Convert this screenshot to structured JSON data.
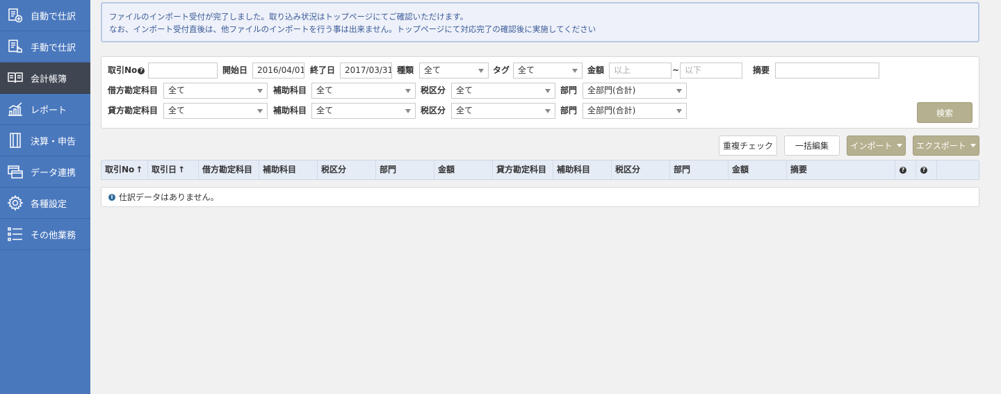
{
  "sidebar": {
    "items": [
      {
        "label": "自動で仕訳",
        "icon": "auto-journal-icon"
      },
      {
        "label": "手動で仕訳",
        "icon": "manual-journal-icon"
      },
      {
        "label": "会計帳簿",
        "icon": "ledger-book-icon",
        "active": true
      },
      {
        "label": "レポート",
        "icon": "report-chart-icon"
      },
      {
        "label": "決算・申告",
        "icon": "settlement-icon"
      },
      {
        "label": "データ連携",
        "icon": "data-link-icon"
      },
      {
        "label": "各種設定",
        "icon": "gear-icon"
      },
      {
        "label": "その他業務",
        "icon": "list-icon"
      }
    ]
  },
  "notice": {
    "line1": "ファイルのインポート受付が完了しました。取り込み状況はトップページにてご確認いただけます。",
    "line2": "なお、インポート受付直後は、他ファイルのインポートを行う事は出来ません。トップページにて対応完了の確認後に実施してください"
  },
  "search": {
    "trade_no_label": "取引No",
    "trade_no_value": "",
    "start_label": "開始日",
    "start_value": "2016/04/01",
    "end_label": "終了日",
    "end_value": "2017/03/31",
    "kind_label": "種類",
    "kind_value": "全て",
    "tag_label": "タグ",
    "tag_value": "全て",
    "amount_label": "金額",
    "amount_min_placeholder": "以上",
    "amount_sep": "~",
    "amount_max_placeholder": "以下",
    "memo_label": "摘要",
    "memo_value": "",
    "debit_label": "借方勘定科目",
    "debit_value": "全て",
    "debit_sub_label": "補助科目",
    "debit_sub_value": "全て",
    "debit_tax_label": "税区分",
    "debit_tax_value": "全て",
    "debit_dept_label": "部門",
    "debit_dept_value": "全部門(合計)",
    "credit_label": "貸方勘定科目",
    "credit_value": "全て",
    "credit_sub_label": "補助科目",
    "credit_sub_value": "全て",
    "credit_tax_label": "税区分",
    "credit_tax_value": "全て",
    "credit_dept_label": "部門",
    "credit_dept_value": "全部門(合計)",
    "search_button": "検索"
  },
  "toolbar": {
    "duplicate_check": "重複チェック",
    "bulk_edit": "一括編集",
    "import": "インポート",
    "export": "エクスポート"
  },
  "table": {
    "headers": [
      "取引No",
      "取引日",
      "借方勘定科目",
      "補助科目",
      "税区分",
      "部門",
      "金額",
      "貸方勘定科目",
      "補助科目",
      "税区分",
      "部門",
      "金額",
      "摘要"
    ],
    "empty_message": "仕訳データはありません。"
  },
  "colors": {
    "sidebar": "#4a78bd",
    "sidebar_active": "#3f4652",
    "notice_text": "#3a5a98",
    "olive_button": "#b5b08f"
  }
}
